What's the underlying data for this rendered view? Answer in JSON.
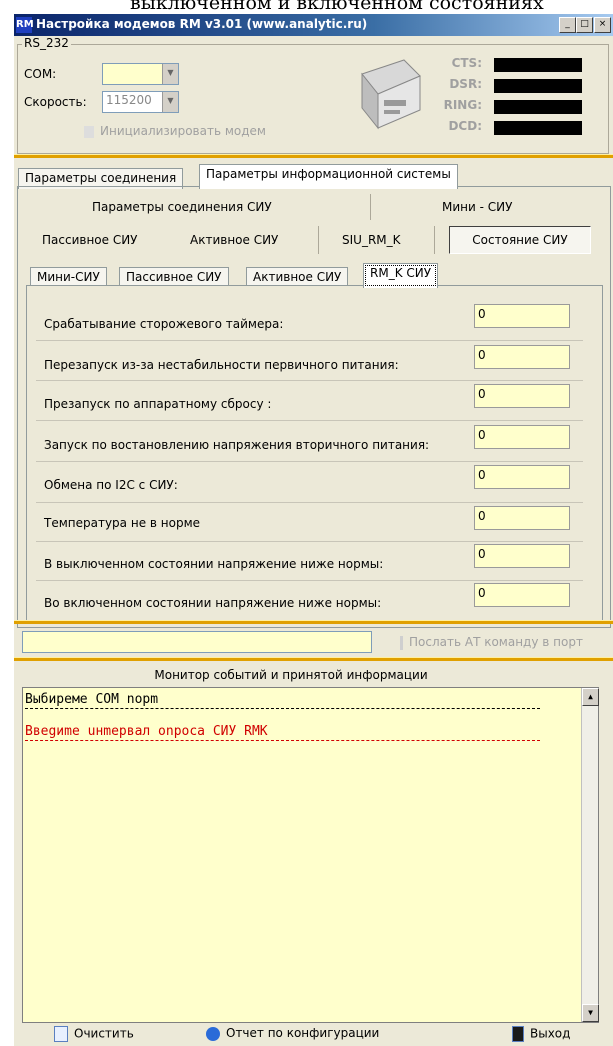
{
  "doc_text": "выключенном и включенном состояниях",
  "window": {
    "title": "Настройка модемов RM v3.01 (www.analytic.ru)",
    "logo": "RM",
    "min": "_",
    "max": "□",
    "close": "×"
  },
  "rs232": {
    "group_label": "RS_232",
    "com_label": "COM:",
    "com_value": "",
    "speed_label": "Скорость:",
    "speed_value": "115200",
    "init_button": "Инициализировать модем",
    "signals": [
      "CTS:",
      "DSR:",
      "RING:",
      "DCD:"
    ]
  },
  "main_tabs": [
    "Параметры соединения",
    "Параметры информационной системы"
  ],
  "sub_groups": {
    "left": "Параметры соединения СИУ",
    "right": "Мини - СИУ"
  },
  "siu_buttons": [
    "Пассивное СИУ",
    "Активное СИУ",
    "SIU_RM_K",
    "Состояние СИУ"
  ],
  "inner_tabs": [
    "Мини-СИУ",
    "Пассивное СИУ",
    "Активное СИУ",
    "RM_K СИУ"
  ],
  "fields": [
    {
      "label": "Срабатывание сторожевого таймера:",
      "value": "0"
    },
    {
      "label": "Перезапуск из-за нестабильности первичного питания:",
      "value": "0"
    },
    {
      "label": "Презапуск по аппаратному сбросу :",
      "value": "0"
    },
    {
      "label": "Запуск по востановлению напряжения вторичного питания:",
      "value": "0"
    },
    {
      "label": "Обмена по I2C с СИУ:",
      "value": "0"
    },
    {
      "label": "Температура не в норме",
      "value": "0"
    },
    {
      "label": "В выключенном состоянии  напряжение ниже нормы:",
      "value": "0"
    },
    {
      "label": "Во включенном состоянии  напряжение ниже нормы:",
      "value": "0"
    }
  ],
  "at_command": {
    "value": "",
    "button": "Послать АТ команду в порт"
  },
  "monitor": {
    "title": "Монитор событий и  принятой информации",
    "lines": [
      {
        "text": "Выбиреме COM nорm",
        "color": "#000000"
      },
      {
        "text": "Ввеgиme uнmервал оnроса СИУ RMK",
        "color": "#d00000"
      }
    ]
  },
  "bottom": {
    "clear": "Очистить",
    "report": "Отчет по конфигурации",
    "exit": "Выход"
  }
}
